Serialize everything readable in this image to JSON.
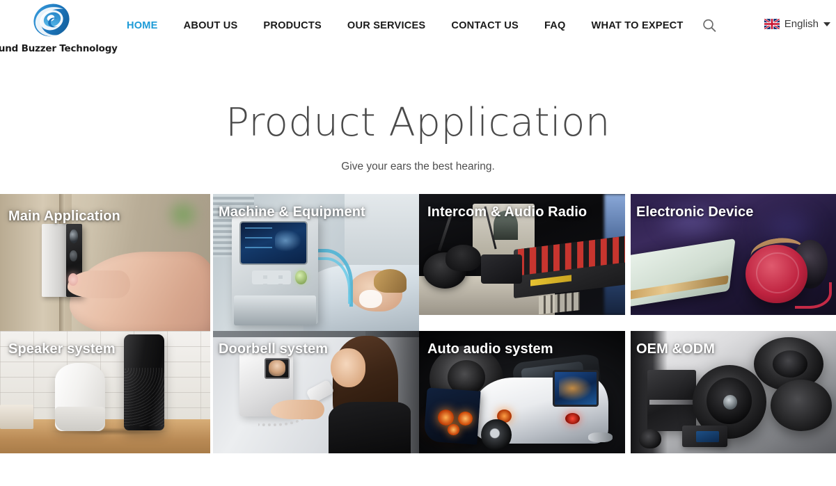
{
  "header": {
    "logo": {
      "icon": "sound-wave-swirl-logo",
      "text": "Sound Buzzer Technology",
      "color": "#1b75bb"
    },
    "nav": [
      {
        "label": "HOME",
        "active": true
      },
      {
        "label": "ABOUT US",
        "active": false
      },
      {
        "label": "PRODUCTS",
        "active": false
      },
      {
        "label": "OUR SERVICES",
        "active": false
      },
      {
        "label": "CONTACT US",
        "active": false
      },
      {
        "label": "FAQ",
        "active": false
      },
      {
        "label": "WHAT TO EXPECT",
        "active": false
      }
    ],
    "search_icon": "search-icon",
    "language": {
      "flag": "uk-flag-icon",
      "label": "English",
      "caret": "chevron-down-icon"
    },
    "active_color": "#1d9bd7"
  },
  "hero": {
    "title": "Product Application",
    "subtitle": "Give your ears the best hearing."
  },
  "gallery": {
    "tiles": [
      {
        "label": "Main Application",
        "image": "doorbell-finger-press-photo"
      },
      {
        "label": "Machine & Equipment",
        "image": "medical-ventilator-patient-photo"
      },
      {
        "label": "Intercom & Audio Radio",
        "image": "radio-studio-mixing-console-photo"
      },
      {
        "label": "Electronic Device",
        "image": "red-headphones-tablet-photo"
      },
      {
        "label": "Speaker system",
        "image": "smart-speakers-on-table-photo"
      },
      {
        "label": "Doorbell system",
        "image": "video-intercom-woman-photo"
      },
      {
        "label": "Auto audio system",
        "image": "white-sports-car-audio-photo"
      },
      {
        "label": "OEM &ODM",
        "image": "car-speaker-drivers-photo"
      }
    ]
  }
}
